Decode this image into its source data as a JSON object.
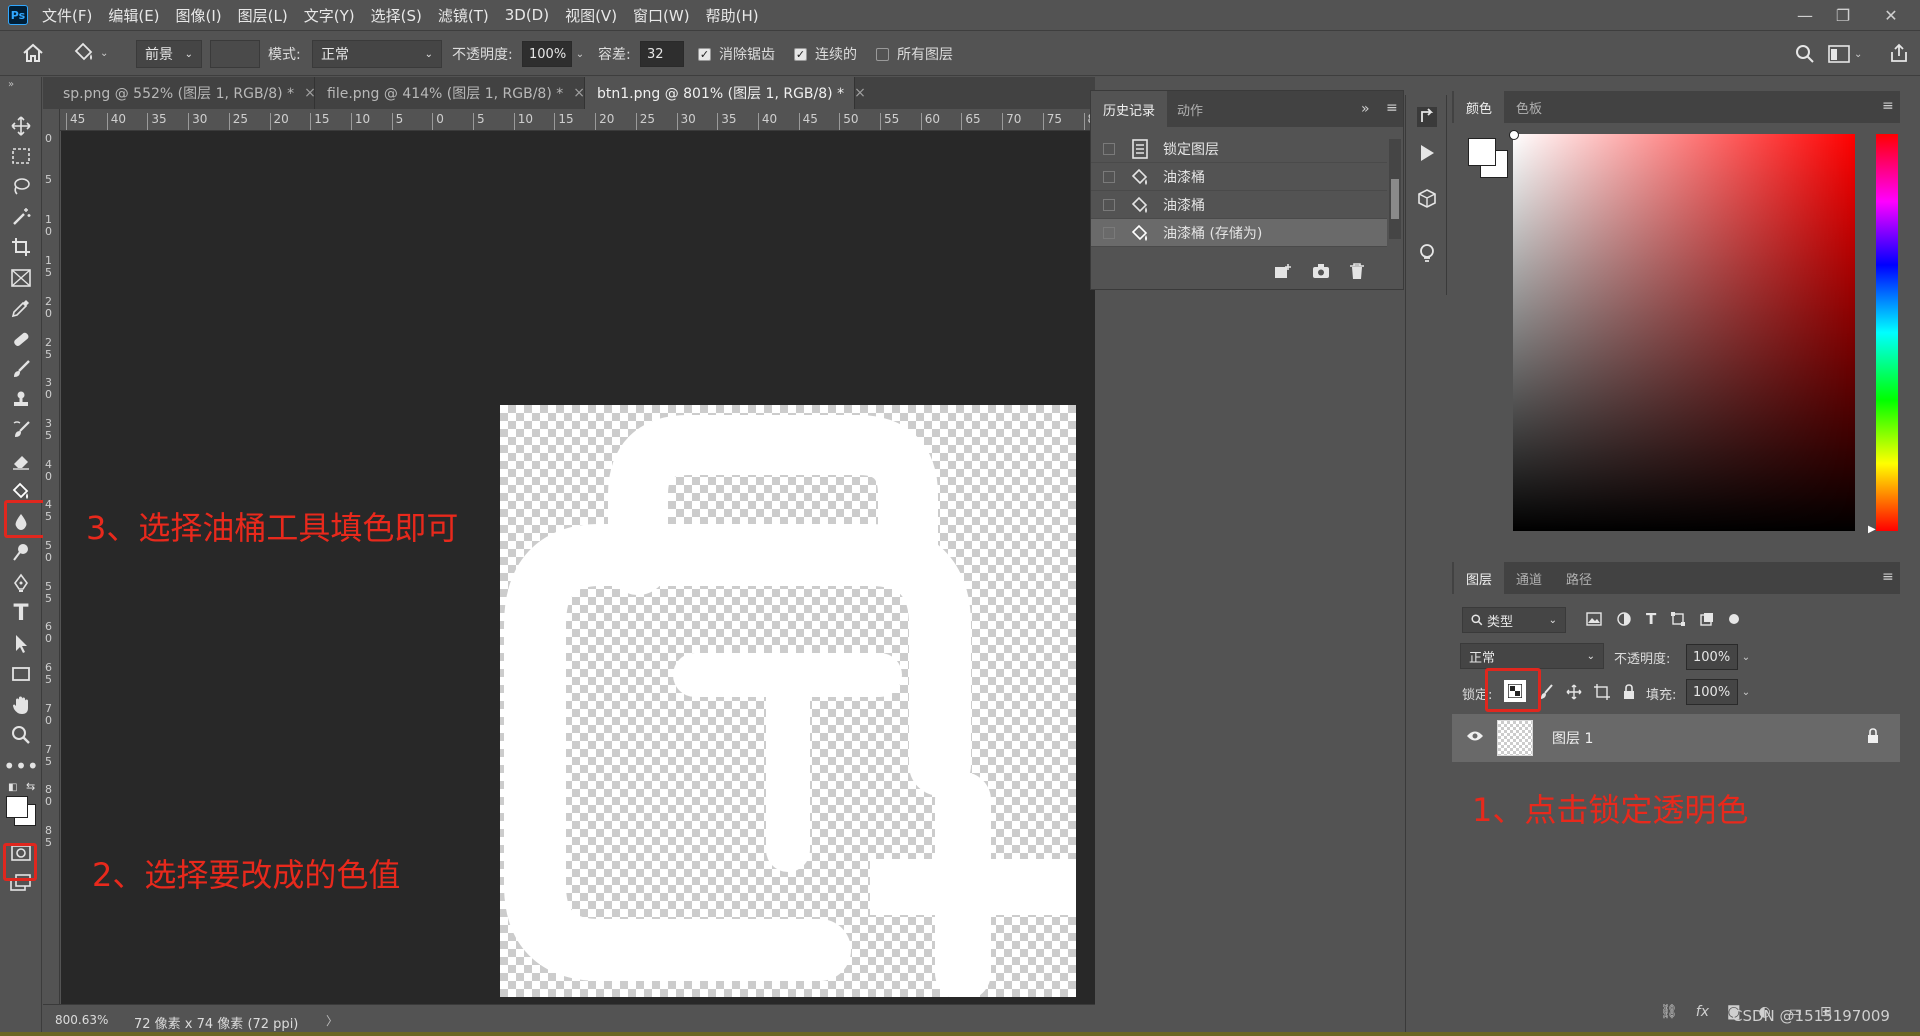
{
  "menu": {
    "logo": "Ps",
    "items": [
      "文件(F)",
      "编辑(E)",
      "图像(I)",
      "图层(L)",
      "文字(Y)",
      "选择(S)",
      "滤镜(T)",
      "3D(D)",
      "视图(V)",
      "窗口(W)",
      "帮助(H)"
    ]
  },
  "options": {
    "fill_source": "前景",
    "mode_label": "模式:",
    "mode_value": "正常",
    "opacity_label": "不透明度:",
    "opacity_value": "100%",
    "tolerance_label": "容差:",
    "tolerance_value": "32",
    "antialias_label": "消除锯齿",
    "antialias_checked": true,
    "contiguous_label": "连续的",
    "contiguous_checked": true,
    "all_layers_label": "所有图层",
    "all_layers_checked": false
  },
  "documents": {
    "tabs": [
      {
        "label": "sp.png @ 552% (图层 1, RGB/8) *",
        "active": false
      },
      {
        "label": "file.png @ 414% (图层 1, RGB/8) *",
        "active": false
      },
      {
        "label": "btn1.png @ 801% (图层 1, RGB/8) *",
        "active": true
      }
    ],
    "close_glyph": "×",
    "ruler_h": [
      "45",
      "40",
      "35",
      "30",
      "25",
      "20",
      "15",
      "10",
      "5",
      "0",
      "5",
      "10",
      "15",
      "20",
      "25",
      "30",
      "35",
      "40",
      "45",
      "50",
      "55",
      "60",
      "65",
      "70",
      "75",
      "8"
    ],
    "ruler_v": [
      "0",
      "5",
      "1 0",
      "1 5",
      "2 0",
      "2 5",
      "3 0",
      "3 5",
      "4 0",
      "4 5",
      "5 0",
      "5 5",
      "6 0",
      "6 5",
      "7 0",
      "7 5",
      "8 0",
      "8 5"
    ],
    "zoom": "800.63%",
    "doc_info": "72 像素 x 74 像素 (72 ppi)"
  },
  "history": {
    "tabs": [
      "历史记录",
      "动作"
    ],
    "rows": [
      {
        "label": "锁定图层",
        "icon": "document-icon",
        "active": false
      },
      {
        "label": "油漆桶",
        "icon": "paint-bucket-icon",
        "active": false
      },
      {
        "label": "油漆桶",
        "icon": "paint-bucket-icon",
        "active": false
      },
      {
        "label": "油漆桶 (存储为)",
        "icon": "paint-bucket-icon",
        "active": true
      }
    ],
    "collapse_glyph": "»"
  },
  "color_panel": {
    "tabs": [
      "颜色",
      "色板"
    ],
    "foreground": "#ffffff",
    "background": "#ffffff"
  },
  "layers_panel": {
    "tabs": [
      "图层",
      "通道",
      "路径"
    ],
    "filter_label": "类型",
    "blend_mode": "正常",
    "opacity_label": "不透明度:",
    "opacity_value": "100%",
    "lock_label": "锁定:",
    "fill_label": "填充:",
    "fill_value": "100%",
    "layer_name": "图层 1"
  },
  "annotations": {
    "step1": "1、点击锁定透明色",
    "step2": "2、选择要改成的色值",
    "step3": "3、选择油桶工具填色即可",
    "color": "#e8291c"
  },
  "watermark": "CSDN @1515197009"
}
